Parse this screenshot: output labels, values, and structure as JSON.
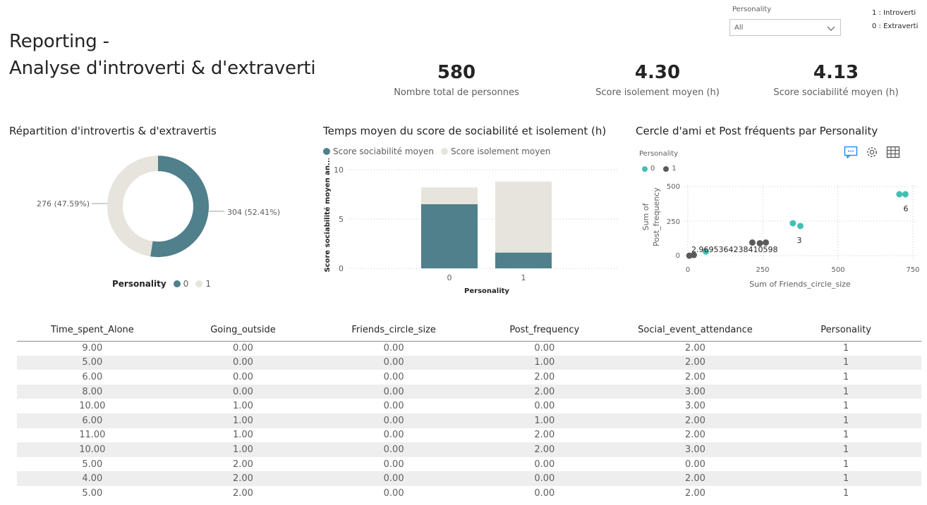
{
  "header": {
    "title_line1": "Reporting -",
    "title_line2": "Analyse d'introverti & d'extraverti"
  },
  "slicer": {
    "label": "Personality",
    "value": "All"
  },
  "legend_note": {
    "line1": "1 : Introverti",
    "line2": "0 : Extraverti"
  },
  "kpis": [
    {
      "value": "580",
      "label": "Nombre total de personnes"
    },
    {
      "value": "4.30",
      "label": "Score isolement moyen (h)"
    },
    {
      "value": "4.13",
      "label": "Score sociabilité moyen (h)"
    }
  ],
  "colors": {
    "teal": "#4f808b",
    "beige": "#e6e4dc",
    "scatter0": "#41c1b4",
    "scatter1": "#5a5a5a",
    "accent": "#118dff"
  },
  "donut": {
    "title": "Répartition d'introvertis & d'extravertis",
    "legend_title": "Personality",
    "legend_items": [
      "0",
      "1"
    ],
    "chart_data": {
      "type": "pie",
      "categories": [
        "0",
        "1"
      ],
      "values": [
        304,
        276
      ],
      "data_labels": [
        "304 (52.41%)",
        "276 (47.59%)"
      ]
    }
  },
  "bar": {
    "title": "Temps moyen du score de sociabilité et isolement (h)",
    "legend_items": [
      "Score sociabilité moyen",
      "Score isolement moyen"
    ],
    "ylabel": "Score sociabilité moyen an...",
    "xlabel": "Personality",
    "y_ticks": [
      "10",
      "5",
      "0"
    ],
    "chart_data": {
      "type": "bar",
      "stacked": true,
      "categories": [
        "0",
        "1"
      ],
      "series": [
        {
          "name": "Score sociabilité moyen",
          "values": [
            6.5,
            1.6
          ]
        },
        {
          "name": "Score isolement moyen",
          "values": [
            1.7,
            7.2
          ]
        }
      ],
      "ylim": [
        0,
        10
      ]
    }
  },
  "scatter": {
    "title": "Cercle d'ami et Post fréquents par Personality",
    "legend_title": "Personality",
    "legend_items": [
      "0",
      "1"
    ],
    "ylabel_line1": "Sum of",
    "ylabel_line2": "Post_frequency",
    "xlabel": "Sum of Friends_circle_size",
    "x_ticks": [
      "0",
      "250",
      "500",
      "750"
    ],
    "y_ticks": [
      "500",
      "250",
      "0"
    ],
    "annotations": [
      "2.9695364238410598",
      "3",
      "6"
    ],
    "chart_data": {
      "type": "scatter",
      "xlim": [
        0,
        750
      ],
      "ylim": [
        0,
        500
      ],
      "series": [
        {
          "name": "0",
          "points": [
            [
              60,
              30
            ],
            [
              350,
              235
            ],
            [
              375,
              215
            ],
            [
              705,
              445
            ],
            [
              725,
              445
            ]
          ]
        },
        {
          "name": "1",
          "points": [
            [
              5,
              0
            ],
            [
              20,
              5
            ],
            [
              215,
              95
            ],
            [
              240,
              90
            ],
            [
              260,
              95
            ]
          ]
        }
      ]
    }
  },
  "table": {
    "columns": [
      "Time_spent_Alone",
      "Going_outside",
      "Friends_circle_size",
      "Post_frequency",
      "Social_event_attendance",
      "Personality"
    ],
    "rows": [
      [
        "9.00",
        "0.00",
        "0.00",
        "0.00",
        "2.00",
        "1"
      ],
      [
        "5.00",
        "0.00",
        "0.00",
        "1.00",
        "2.00",
        "1"
      ],
      [
        "6.00",
        "0.00",
        "0.00",
        "2.00",
        "2.00",
        "1"
      ],
      [
        "8.00",
        "0.00",
        "0.00",
        "2.00",
        "3.00",
        "1"
      ],
      [
        "10.00",
        "1.00",
        "0.00",
        "0.00",
        "3.00",
        "1"
      ],
      [
        "6.00",
        "1.00",
        "0.00",
        "1.00",
        "2.00",
        "1"
      ],
      [
        "11.00",
        "1.00",
        "0.00",
        "2.00",
        "2.00",
        "1"
      ],
      [
        "10.00",
        "1.00",
        "0.00",
        "2.00",
        "3.00",
        "1"
      ],
      [
        "5.00",
        "2.00",
        "0.00",
        "0.00",
        "0.00",
        "1"
      ],
      [
        "4.00",
        "2.00",
        "0.00",
        "0.00",
        "2.00",
        "1"
      ],
      [
        "5.00",
        "2.00",
        "0.00",
        "0.00",
        "2.00",
        "1"
      ]
    ]
  }
}
